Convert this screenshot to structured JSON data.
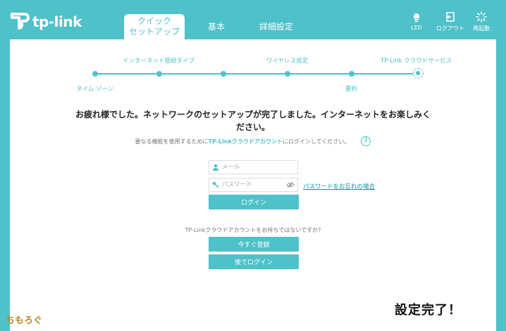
{
  "brand": {
    "name": "tp-link"
  },
  "nav": {
    "tabs": [
      {
        "line1": "クイック",
        "line2": "セットアップ",
        "active": true
      },
      {
        "label": "基本"
      },
      {
        "label": "詳細設定"
      }
    ]
  },
  "header_buttons": {
    "led": "LED",
    "logout": "ログアウト",
    "reboot": "再起動"
  },
  "stepper": {
    "steps": [
      {
        "label": "タイム ゾーン",
        "position": "below"
      },
      {
        "label": "インターネット接続タイプ",
        "position": "above"
      },
      {
        "label": "",
        "position": "none"
      },
      {
        "label": "ワイヤレス設定",
        "position": "above"
      },
      {
        "label": "要約",
        "position": "below"
      },
      {
        "label": "TP-Link クラウドサービス",
        "position": "above",
        "current": true
      }
    ]
  },
  "message": {
    "line1": "お疲れ様でした。ネットワークのセットアップが完了しました。インターネットをお楽しみく",
    "line2": "ださい。"
  },
  "hint": {
    "pre": "要なる機能を使用するためにTP-Linkクラウドアカウントにログインしてください。",
    "pre_text": "要なる機能を使用するために",
    "brand_text": "TP-Linkクラウドアカウント",
    "post_text": "にログインしてください。"
  },
  "login": {
    "email_placeholder": "メール",
    "password_placeholder": "パスワード",
    "forgot": "パスワードをお忘れの場合",
    "login_button": "ログイン"
  },
  "signup": {
    "prompt": "TP-Linkクラウドアカウントをお持ちではないですか?",
    "register_button": "今すぐ登録",
    "later_button": "後でログイン"
  },
  "overlay": {
    "watermark": "ちもろぐ",
    "caption": "設定完了！"
  },
  "colors": {
    "accent": "#4ec1c9",
    "link": "#1e88a8"
  }
}
